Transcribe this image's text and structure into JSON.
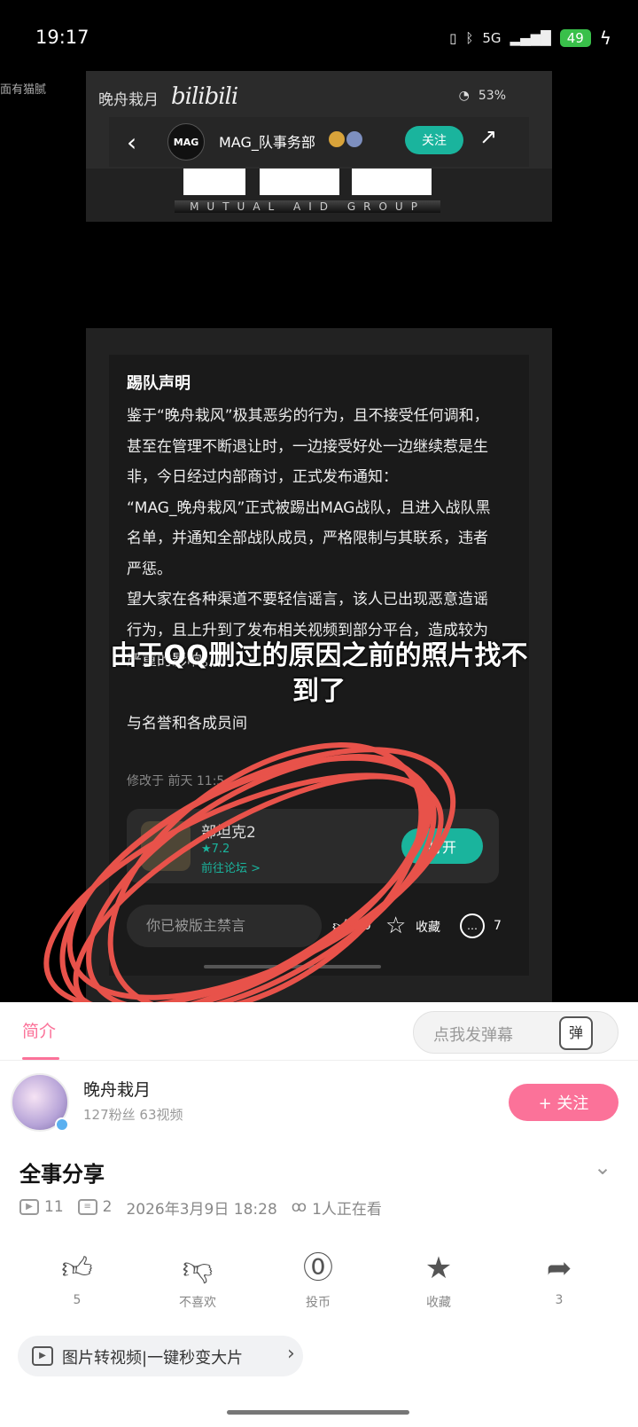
{
  "status_bar": {
    "time": "19:17",
    "signal": "5G",
    "battery": "49"
  },
  "corner_text": "面有猫腻",
  "embedded": {
    "app_title": "晚舟栽月",
    "logo": "bilibili",
    "sys_status": "53%",
    "account_name": "MAG_队事务部",
    "avatar_text": "MAG",
    "follow_label": "关注",
    "logo_tagline": "MUTUAL AID GROUP",
    "post": {
      "title": "踢队声明",
      "paragraphs": [
        "鉴于“晚舟栽风”极其恶劣的行为，且不接受任何调和，甚至在管理不断退让时，一边接受好处一边继续惹是生非，今日经过内部商讨，正式发布通知：",
        "“MAG_晚舟栽风”正式被踢出MAG战队，且进入战队黑名单，并通知全部战队成员，严格限制与其联系，违者严惩。",
        "望大家在各种渠道不要轻信谣言，该人已出现恶意造谣行为，且上升到了发布相关视频到部分平台，造成较为严重的影响。",
        "与名誉和各成员间"
      ],
      "edited": "修改于 前天 11:5"
    },
    "game_card": {
      "name": "部坦克2",
      "rating": "★7.2",
      "link": "前往论坛 >",
      "open_label": "打开"
    },
    "comment_bar": {
      "placeholder": "你已被版主禁言",
      "like_count": "10",
      "fav_label": "收藏",
      "comment_count": "7"
    }
  },
  "overlay_caption": "由于QQ删过的原因之前的照片找不到了",
  "tabs": [
    {
      "label": "简介",
      "active": true
    }
  ],
  "danmaku": {
    "placeholder": "点我发弹幕",
    "icon_label": "弹"
  },
  "uploader": {
    "name": "晚舟栽月",
    "stats": "127粉丝   63视频",
    "follow_label": "+ 关注"
  },
  "video": {
    "title": "全事分享",
    "plays": "11",
    "danmaku_count": "2",
    "date": "2026年3月9日  18:28",
    "watching": "1人正在看"
  },
  "actions": [
    {
      "icon": "thumb-up-icon",
      "label": "5"
    },
    {
      "icon": "thumb-down-icon",
      "label": "不喜欢"
    },
    {
      "icon": "coin-icon",
      "label": "投币"
    },
    {
      "icon": "star-icon",
      "label": "收藏"
    },
    {
      "icon": "share-icon",
      "label": "3"
    }
  ],
  "promo": {
    "text": "图片转视频|一键秒变大片"
  },
  "colors": {
    "accent": "#fb7299",
    "green": "#1ab49d",
    "scribble": "#e8524a"
  }
}
